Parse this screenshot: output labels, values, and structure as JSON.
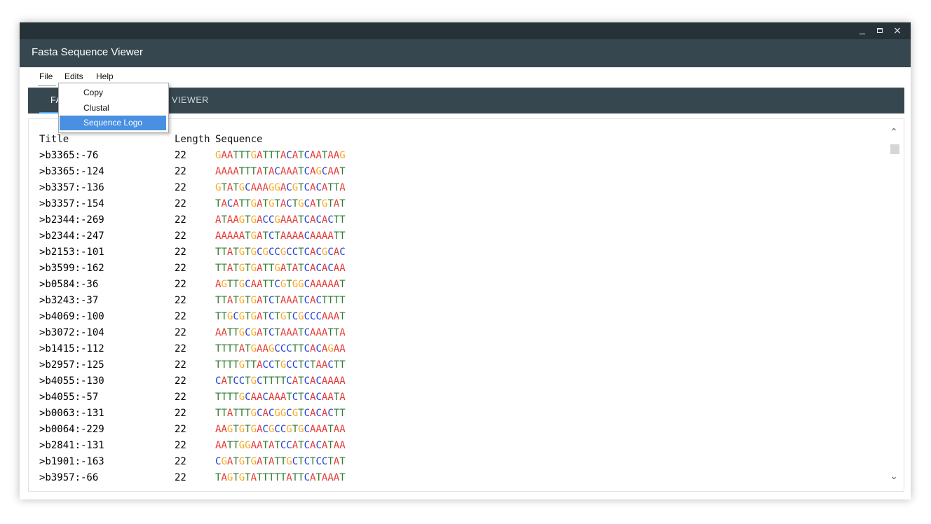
{
  "window": {
    "title": "Fasta Sequence Viewer",
    "controls": {
      "minimize": "minimize-icon",
      "maximize": "maximize-icon",
      "close": "×"
    }
  },
  "menubar": {
    "file": "File",
    "edits": "Edits",
    "help": "Help"
  },
  "dropdown": {
    "items": [
      "Copy",
      "Clustal",
      "Sequence Logo"
    ],
    "selected": "Sequence Logo"
  },
  "tabs": {
    "first_visible": "FA",
    "second_visible": "VIEWER"
  },
  "table": {
    "headers": [
      "Title",
      "Length",
      "Sequence"
    ],
    "rows": [
      [
        ">b3365:-76",
        "22",
        "GAATTTGATTTACATCAATAAG"
      ],
      [
        ">b3365:-124",
        "22",
        "AAAATTTATACAAATCAGCAAT"
      ],
      [
        ">b3357:-136",
        "22",
        "GTATGCAAAGGACGTCACATTA"
      ],
      [
        ">b3357:-154",
        "22",
        "TACATTGATGTACTGCATGTAT"
      ],
      [
        ">b2344:-269",
        "22",
        "ATAAGTGACCGAAATCACACTT"
      ],
      [
        ">b2344:-247",
        "22",
        "AAAAATGATCTAAAACAAAATT"
      ],
      [
        ">b2153:-101",
        "22",
        "TTATGTGCGCCGCCTCACGCAC"
      ],
      [
        ">b3599:-162",
        "22",
        "TTATGTGATTGATATCACACAA"
      ],
      [
        ">b0584:-36",
        "22",
        "AGTTGCAATTCGTGGCAAAAAT"
      ],
      [
        ">b3243:-37",
        "22",
        "TTATGTGATCTAAATCACTTTT"
      ],
      [
        ">b4069:-100",
        "22",
        "TTGCGTGATCTGTCGCCCAAAT"
      ],
      [
        ">b3072:-104",
        "22",
        "AATTGCGATCTAAATCAAATTA"
      ],
      [
        ">b1415:-112",
        "22",
        "TTTTATGAAGCCCTTCACAGAA"
      ],
      [
        ">b2957:-125",
        "22",
        "TTTTGTTACCTGCCTCTAACTT"
      ],
      [
        ">b4055:-130",
        "22",
        "CATCCTGCTTTTCATCACAAAA"
      ],
      [
        ">b4055:-57",
        "22",
        "TTTTGCAACAAATCTCACAATA"
      ],
      [
        ">b0063:-131",
        "22",
        "TTATTTGCACGGCGTCACACTT"
      ],
      [
        ">b0064:-229",
        "22",
        "AAGTGTGACGCCGTGCAAATAA"
      ],
      [
        ">b2841:-131",
        "22",
        "AATTGGAATATCCATCACATAA"
      ],
      [
        ">b1901:-163",
        "22",
        "CGATGTGATATTGCTCTCCTAT"
      ],
      [
        ">b3957:-66",
        "22",
        "TAGTGTATTTTTATTCATAAAT"
      ]
    ]
  },
  "nucleotide_colors": {
    "A": "#e53935",
    "T": "#2e7d32",
    "G": "#f9a825",
    "C": "#1e3fd6"
  },
  "scrollbar": {
    "up": "chevron-up-icon",
    "down": "chevron-down-icon"
  }
}
